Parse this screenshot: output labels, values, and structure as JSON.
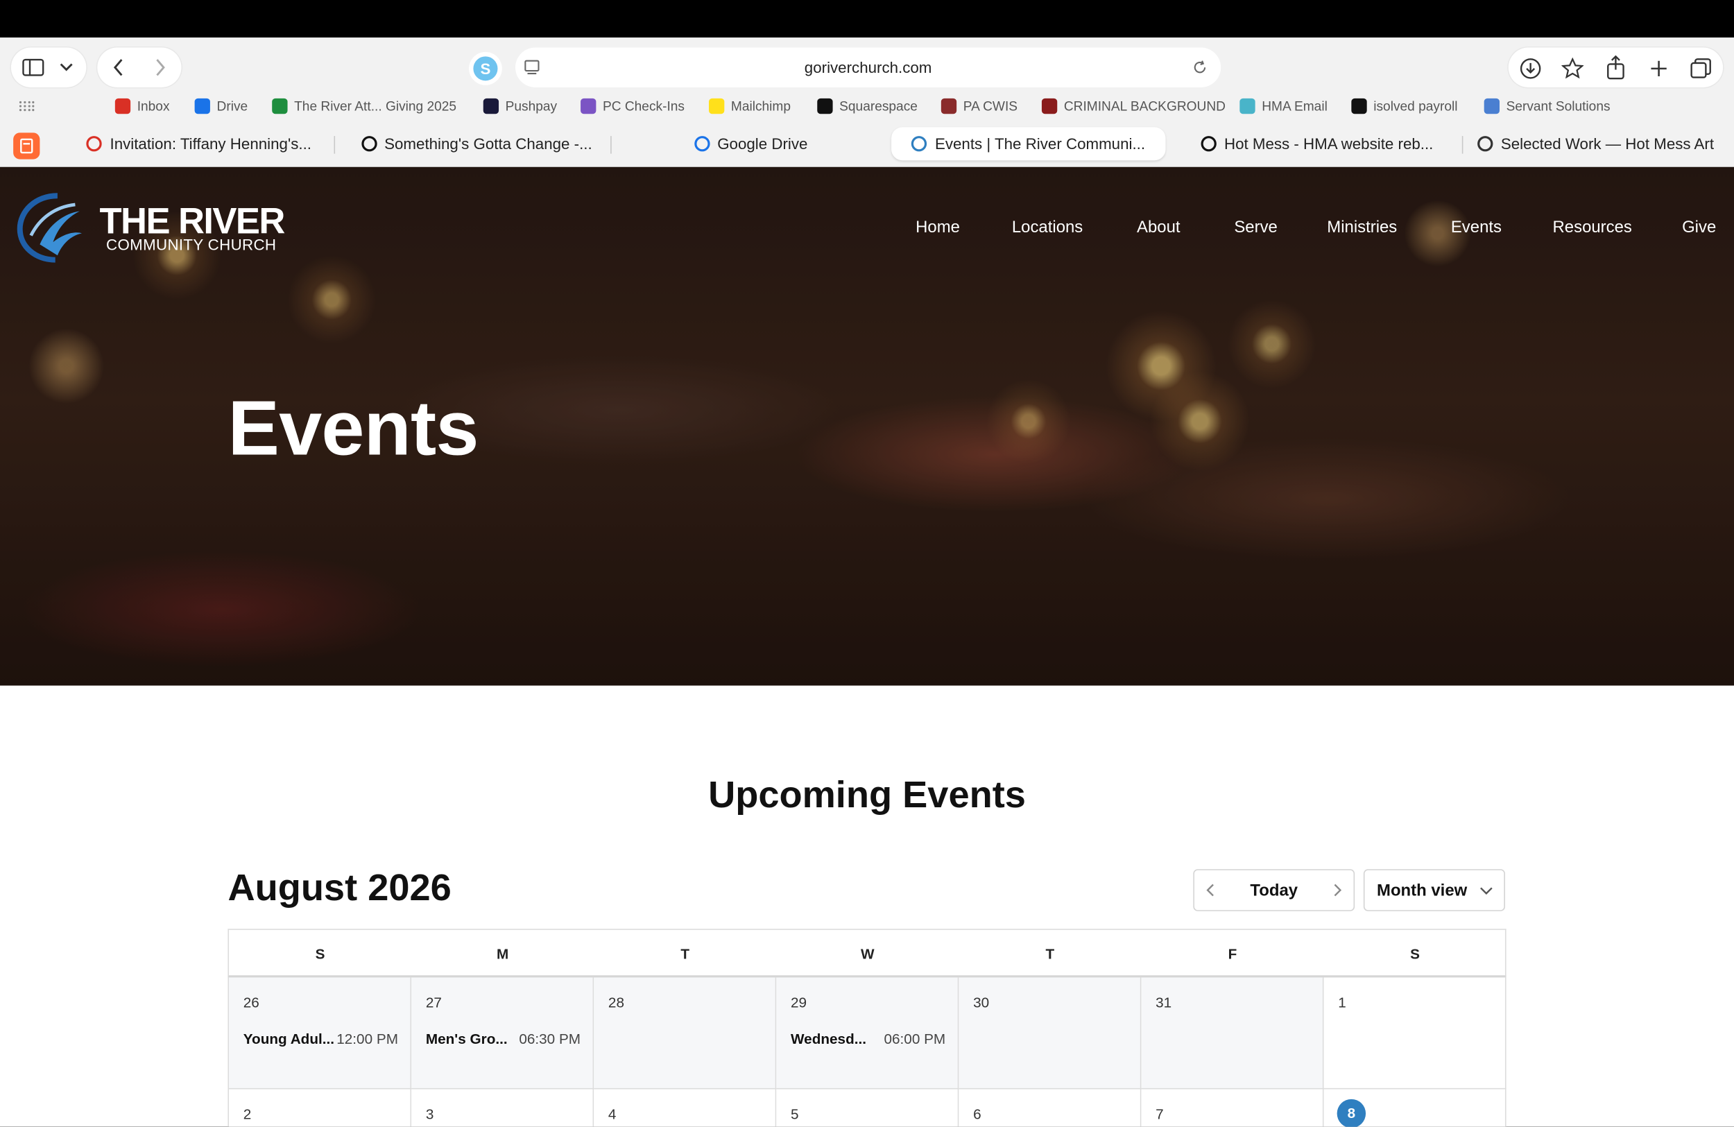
{
  "browser": {
    "url": "goriverchurch.com",
    "bookmarks": [
      {
        "label": "Inbox",
        "icon": "gmail-icon",
        "color": "#d93025"
      },
      {
        "label": "Drive",
        "icon": "drive-icon",
        "color": "#1a73e8"
      },
      {
        "label": "The River Att... Giving 2025",
        "icon": "sheets-icon",
        "color": "#1e8e3e"
      },
      {
        "label": "Pushpay",
        "icon": "pushpay-icon",
        "color": "#1a1a3a"
      },
      {
        "label": "PC Check-Ins",
        "icon": "checkin-icon",
        "color": "#7b54c4"
      },
      {
        "label": "Mailchimp",
        "icon": "mailchimp-icon",
        "color": "#ffe01b"
      },
      {
        "label": "Squarespace",
        "icon": "squarespace-icon",
        "color": "#111111"
      },
      {
        "label": "PA CWIS",
        "icon": "pa-icon",
        "color": "#8a2b2b"
      },
      {
        "label": "CRIMINAL BACKGROUND",
        "icon": "badge-icon",
        "color": "#8a1c1c"
      },
      {
        "label": "HMA Email",
        "icon": "hma-icon",
        "color": "#49b4c9"
      },
      {
        "label": "isolved payroll",
        "icon": "isolved-icon",
        "color": "#111111"
      },
      {
        "label": "Servant Solutions",
        "icon": "doc-icon",
        "color": "#4a7fd1"
      }
    ],
    "tabs": [
      {
        "label": "Invitation: Tiffany Henning's...",
        "icon": "gmail-icon",
        "color": "#d93025"
      },
      {
        "label": "Something's Gotta Change -...",
        "icon": "openai-icon",
        "color": "#111111"
      },
      {
        "label": "Google Drive",
        "icon": "drive-icon",
        "color": "#1a73e8"
      },
      {
        "label": "Events | The River Communi...",
        "icon": "river-icon",
        "color": "#2f7fc0"
      },
      {
        "label": "Hot Mess - HMA website reb...",
        "icon": "openai-icon",
        "color": "#111111"
      },
      {
        "label": "Selected Work — Hot Mess Art",
        "icon": "cube-icon",
        "color": "#333333"
      }
    ]
  },
  "site": {
    "logo_line1": "THE RIVER",
    "logo_line2": "COMMUNITY CHURCH",
    "nav": [
      "Home",
      "Locations",
      "About",
      "Serve",
      "Ministries",
      "Events",
      "Resources",
      "Give"
    ],
    "hero_title": "Events",
    "section_title": "Upcoming Events",
    "accent": "#2f7fc0"
  },
  "calendar": {
    "month_title": "August 2026",
    "today_label": "Today",
    "view_label": "Month view",
    "weekdays": [
      "S",
      "M",
      "T",
      "W",
      "T",
      "F",
      "S"
    ],
    "week1": [
      {
        "day": "26",
        "event": "Young Adul...",
        "time": "12:00 PM"
      },
      {
        "day": "27",
        "event": "Men's Gro...",
        "time": "06:30 PM"
      },
      {
        "day": "28",
        "event": "",
        "time": ""
      },
      {
        "day": "29",
        "event": "Wednesd...",
        "time": "06:00 PM"
      },
      {
        "day": "30",
        "event": "",
        "time": ""
      },
      {
        "day": "31",
        "event": "",
        "time": ""
      },
      {
        "day": "1",
        "event": "",
        "time": ""
      }
    ],
    "week2": [
      {
        "day": "2"
      },
      {
        "day": "3"
      },
      {
        "day": "4"
      },
      {
        "day": "5"
      },
      {
        "day": "6"
      },
      {
        "day": "7"
      },
      {
        "day": "8",
        "is_today": true
      }
    ]
  }
}
